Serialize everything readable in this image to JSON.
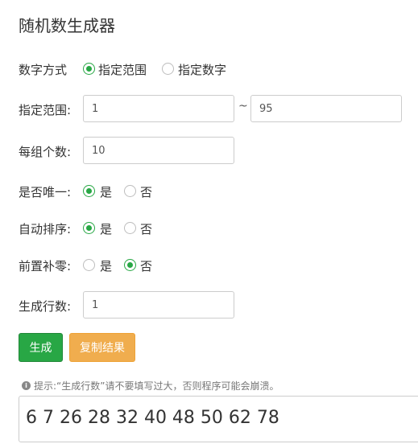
{
  "title": "随机数生成器",
  "number_mode": {
    "label": "数字方式",
    "options": [
      {
        "label": "指定范围",
        "selected": true
      },
      {
        "label": "指定数字",
        "selected": false
      }
    ]
  },
  "range": {
    "label": "指定范围:",
    "min": "1",
    "separator": "~",
    "max": "95"
  },
  "group_count": {
    "label": "每组个数:",
    "value": "10"
  },
  "unique": {
    "label": "是否唯一:",
    "yes": "是",
    "no": "否",
    "selected": "yes"
  },
  "auto_sort": {
    "label": "自动排序:",
    "yes": "是",
    "no": "否",
    "selected": "yes"
  },
  "zero_pad": {
    "label": "前置补零:",
    "yes": "是",
    "no": "否",
    "selected": "no"
  },
  "rows": {
    "label": "生成行数:",
    "value": "1"
  },
  "buttons": {
    "generate": "生成",
    "copy": "复制结果"
  },
  "tip": "提示:“生成行数”请不要填写过大，否则程序可能会崩溃。",
  "result": "6 7 26 28 32 40 48 50 62 78",
  "colors": {
    "accent": "#28a745",
    "copy_button": "#f0ad4e"
  }
}
